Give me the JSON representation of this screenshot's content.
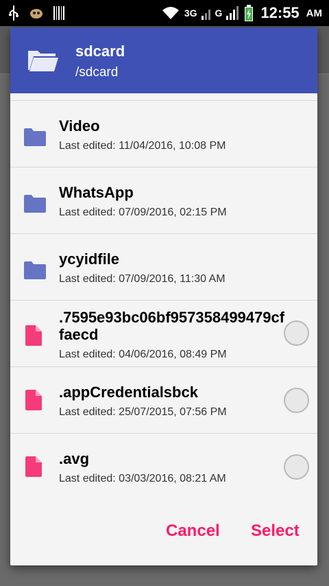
{
  "status_bar": {
    "network_1": "3G",
    "network_2": "G",
    "time": "12:55",
    "ampm": "AM"
  },
  "dialog": {
    "title": "sdcard",
    "path": "/sdcard",
    "items": [
      {
        "name": "Video",
        "date": "Last edited: 11/04/2016, 10:08 PM",
        "type": "folder"
      },
      {
        "name": "WhatsApp",
        "date": "Last edited: 07/09/2016, 02:15 PM",
        "type": "folder"
      },
      {
        "name": "ycyidfile",
        "date": "Last edited: 07/09/2016, 11:30 AM",
        "type": "folder"
      },
      {
        "name": ".7595e93bc06bf957358499479cffaecd",
        "date": "Last edited: 04/06/2016, 08:49 PM",
        "type": "file"
      },
      {
        "name": ".appCredentialsbck",
        "date": "Last edited: 25/07/2015, 07:56 PM",
        "type": "file"
      },
      {
        "name": ".avg",
        "date": "Last edited: 03/03/2016, 08:21 AM",
        "type": "file"
      }
    ],
    "cancel_label": "Cancel",
    "select_label": "Select"
  },
  "colors": {
    "header": "#3f51b5",
    "folder_icon": "#6674c4",
    "file_icon": "#f53b79",
    "accent": "#ff1a6a"
  },
  "icons": {
    "header": "folder-open-icon",
    "folder": "folder-icon",
    "file": "file-icon"
  }
}
